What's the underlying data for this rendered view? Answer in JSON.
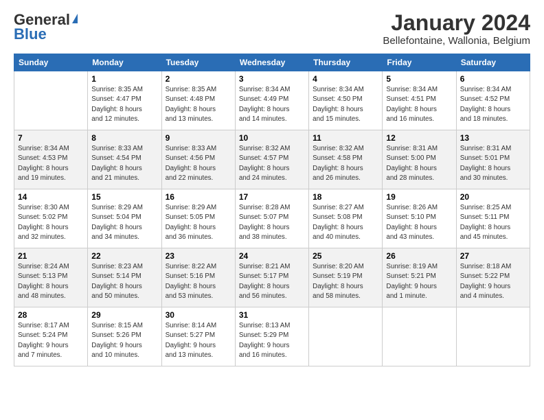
{
  "logo": {
    "general": "General",
    "blue": "Blue"
  },
  "title": "January 2024",
  "location": "Bellefontaine, Wallonia, Belgium",
  "days_of_week": [
    "Sunday",
    "Monday",
    "Tuesday",
    "Wednesday",
    "Thursday",
    "Friday",
    "Saturday"
  ],
  "weeks": [
    [
      {
        "day": "",
        "info": ""
      },
      {
        "day": "1",
        "info": "Sunrise: 8:35 AM\nSunset: 4:47 PM\nDaylight: 8 hours\nand 12 minutes."
      },
      {
        "day": "2",
        "info": "Sunrise: 8:35 AM\nSunset: 4:48 PM\nDaylight: 8 hours\nand 13 minutes."
      },
      {
        "day": "3",
        "info": "Sunrise: 8:34 AM\nSunset: 4:49 PM\nDaylight: 8 hours\nand 14 minutes."
      },
      {
        "day": "4",
        "info": "Sunrise: 8:34 AM\nSunset: 4:50 PM\nDaylight: 8 hours\nand 15 minutes."
      },
      {
        "day": "5",
        "info": "Sunrise: 8:34 AM\nSunset: 4:51 PM\nDaylight: 8 hours\nand 16 minutes."
      },
      {
        "day": "6",
        "info": "Sunrise: 8:34 AM\nSunset: 4:52 PM\nDaylight: 8 hours\nand 18 minutes."
      }
    ],
    [
      {
        "day": "7",
        "info": "Sunrise: 8:34 AM\nSunset: 4:53 PM\nDaylight: 8 hours\nand 19 minutes."
      },
      {
        "day": "8",
        "info": "Sunrise: 8:33 AM\nSunset: 4:54 PM\nDaylight: 8 hours\nand 21 minutes."
      },
      {
        "day": "9",
        "info": "Sunrise: 8:33 AM\nSunset: 4:56 PM\nDaylight: 8 hours\nand 22 minutes."
      },
      {
        "day": "10",
        "info": "Sunrise: 8:32 AM\nSunset: 4:57 PM\nDaylight: 8 hours\nand 24 minutes."
      },
      {
        "day": "11",
        "info": "Sunrise: 8:32 AM\nSunset: 4:58 PM\nDaylight: 8 hours\nand 26 minutes."
      },
      {
        "day": "12",
        "info": "Sunrise: 8:31 AM\nSunset: 5:00 PM\nDaylight: 8 hours\nand 28 minutes."
      },
      {
        "day": "13",
        "info": "Sunrise: 8:31 AM\nSunset: 5:01 PM\nDaylight: 8 hours\nand 30 minutes."
      }
    ],
    [
      {
        "day": "14",
        "info": "Sunrise: 8:30 AM\nSunset: 5:02 PM\nDaylight: 8 hours\nand 32 minutes."
      },
      {
        "day": "15",
        "info": "Sunrise: 8:29 AM\nSunset: 5:04 PM\nDaylight: 8 hours\nand 34 minutes."
      },
      {
        "day": "16",
        "info": "Sunrise: 8:29 AM\nSunset: 5:05 PM\nDaylight: 8 hours\nand 36 minutes."
      },
      {
        "day": "17",
        "info": "Sunrise: 8:28 AM\nSunset: 5:07 PM\nDaylight: 8 hours\nand 38 minutes."
      },
      {
        "day": "18",
        "info": "Sunrise: 8:27 AM\nSunset: 5:08 PM\nDaylight: 8 hours\nand 40 minutes."
      },
      {
        "day": "19",
        "info": "Sunrise: 8:26 AM\nSunset: 5:10 PM\nDaylight: 8 hours\nand 43 minutes."
      },
      {
        "day": "20",
        "info": "Sunrise: 8:25 AM\nSunset: 5:11 PM\nDaylight: 8 hours\nand 45 minutes."
      }
    ],
    [
      {
        "day": "21",
        "info": "Sunrise: 8:24 AM\nSunset: 5:13 PM\nDaylight: 8 hours\nand 48 minutes."
      },
      {
        "day": "22",
        "info": "Sunrise: 8:23 AM\nSunset: 5:14 PM\nDaylight: 8 hours\nand 50 minutes."
      },
      {
        "day": "23",
        "info": "Sunrise: 8:22 AM\nSunset: 5:16 PM\nDaylight: 8 hours\nand 53 minutes."
      },
      {
        "day": "24",
        "info": "Sunrise: 8:21 AM\nSunset: 5:17 PM\nDaylight: 8 hours\nand 56 minutes."
      },
      {
        "day": "25",
        "info": "Sunrise: 8:20 AM\nSunset: 5:19 PM\nDaylight: 8 hours\nand 58 minutes."
      },
      {
        "day": "26",
        "info": "Sunrise: 8:19 AM\nSunset: 5:21 PM\nDaylight: 9 hours\nand 1 minute."
      },
      {
        "day": "27",
        "info": "Sunrise: 8:18 AM\nSunset: 5:22 PM\nDaylight: 9 hours\nand 4 minutes."
      }
    ],
    [
      {
        "day": "28",
        "info": "Sunrise: 8:17 AM\nSunset: 5:24 PM\nDaylight: 9 hours\nand 7 minutes."
      },
      {
        "day": "29",
        "info": "Sunrise: 8:15 AM\nSunset: 5:26 PM\nDaylight: 9 hours\nand 10 minutes."
      },
      {
        "day": "30",
        "info": "Sunrise: 8:14 AM\nSunset: 5:27 PM\nDaylight: 9 hours\nand 13 minutes."
      },
      {
        "day": "31",
        "info": "Sunrise: 8:13 AM\nSunset: 5:29 PM\nDaylight: 9 hours\nand 16 minutes."
      },
      {
        "day": "",
        "info": ""
      },
      {
        "day": "",
        "info": ""
      },
      {
        "day": "",
        "info": ""
      }
    ]
  ]
}
